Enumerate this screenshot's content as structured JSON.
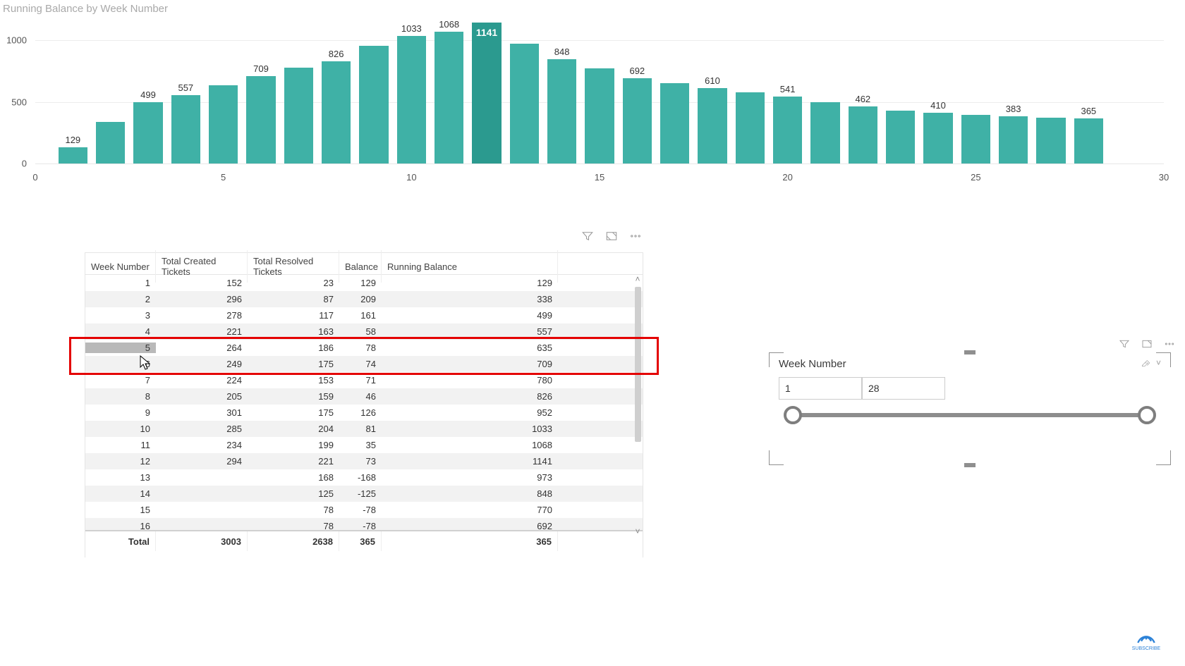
{
  "chart_data": {
    "type": "bar",
    "title": "Running Balance by Week Number",
    "xlabel": "",
    "ylabel": "",
    "ylim": [
      0,
      1200
    ],
    "yticks": [
      0,
      500,
      1000
    ],
    "xticks": [
      0,
      5,
      10,
      15,
      20,
      25,
      30
    ],
    "x_domain": [
      0,
      30
    ],
    "highlight_index": 12,
    "labeled_indices": [
      1,
      3,
      4,
      6,
      8,
      10,
      11,
      12,
      14,
      16,
      18,
      20,
      22,
      24,
      26,
      28
    ],
    "categories": [
      1,
      2,
      3,
      4,
      5,
      6,
      7,
      8,
      9,
      10,
      11,
      12,
      13,
      14,
      15,
      16,
      17,
      18,
      19,
      20,
      21,
      22,
      23,
      24,
      25,
      26,
      27,
      28
    ],
    "values": [
      129,
      338,
      499,
      557,
      635,
      709,
      780,
      826,
      952,
      1033,
      1068,
      1141,
      973,
      848,
      770,
      692,
      650,
      610,
      580,
      541,
      500,
      462,
      430,
      410,
      395,
      383,
      370,
      365
    ]
  },
  "table": {
    "headers": [
      "Week Number",
      "Total Created Tickets",
      "Total Resolved Tickets",
      "Balance",
      "Running Balance"
    ],
    "rows": [
      {
        "wk": "1",
        "created": "152",
        "resolved": "23",
        "bal": "129",
        "run": "129"
      },
      {
        "wk": "2",
        "created": "296",
        "resolved": "87",
        "bal": "209",
        "run": "338"
      },
      {
        "wk": "3",
        "created": "278",
        "resolved": "117",
        "bal": "161",
        "run": "499"
      },
      {
        "wk": "4",
        "created": "221",
        "resolved": "163",
        "bal": "58",
        "run": "557"
      },
      {
        "wk": "5",
        "created": "264",
        "resolved": "186",
        "bal": "78",
        "run": "635"
      },
      {
        "wk": "6",
        "created": "249",
        "resolved": "175",
        "bal": "74",
        "run": "709"
      },
      {
        "wk": "7",
        "created": "224",
        "resolved": "153",
        "bal": "71",
        "run": "780"
      },
      {
        "wk": "8",
        "created": "205",
        "resolved": "159",
        "bal": "46",
        "run": "826"
      },
      {
        "wk": "9",
        "created": "301",
        "resolved": "175",
        "bal": "126",
        "run": "952"
      },
      {
        "wk": "10",
        "created": "285",
        "resolved": "204",
        "bal": "81",
        "run": "1033"
      },
      {
        "wk": "11",
        "created": "234",
        "resolved": "199",
        "bal": "35",
        "run": "1068"
      },
      {
        "wk": "12",
        "created": "294",
        "resolved": "221",
        "bal": "73",
        "run": "1141"
      },
      {
        "wk": "13",
        "created": "",
        "resolved": "168",
        "bal": "-168",
        "run": "973"
      },
      {
        "wk": "14",
        "created": "",
        "resolved": "125",
        "bal": "-125",
        "run": "848"
      },
      {
        "wk": "15",
        "created": "",
        "resolved": "78",
        "bal": "-78",
        "run": "770"
      },
      {
        "wk": "16",
        "created": "",
        "resolved": "78",
        "bal": "-78",
        "run": "692"
      }
    ],
    "total": {
      "label": "Total",
      "created": "3003",
      "resolved": "2638",
      "bal": "365",
      "run": "365"
    },
    "selected_index": 4
  },
  "slicer": {
    "title": "Week Number",
    "from": "1",
    "to": "28"
  },
  "badge": {
    "text": "SUBSCRIBE"
  }
}
